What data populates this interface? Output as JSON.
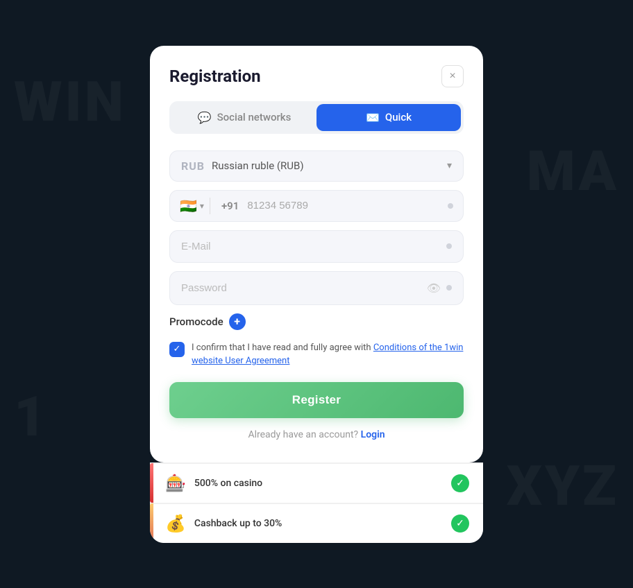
{
  "modal": {
    "title": "Registration",
    "close_label": "×",
    "tabs": [
      {
        "id": "social",
        "label": "Social networks",
        "icon": "💬",
        "active": false
      },
      {
        "id": "quick",
        "label": "Quick",
        "icon": "✉️",
        "active": true
      }
    ],
    "currency": {
      "code": "RUB",
      "name": "Russian ruble (RUB)",
      "chevron": "▾"
    },
    "phone": {
      "flag": "🇮🇳",
      "country_code": "+91",
      "placeholder": "81234 56789"
    },
    "email": {
      "placeholder": "E-Mail"
    },
    "password": {
      "placeholder": "Password"
    },
    "promocode": {
      "label": "Promocode",
      "add_icon": "+"
    },
    "agreement": {
      "text": "I confirm that I have read and fully agree with ",
      "link_text": "Conditions of the 1win website User Agreement"
    },
    "register_button": "Register",
    "login_text": "Already have an account?",
    "login_link": "Login"
  },
  "bonuses": [
    {
      "icon": "🎰",
      "text": "500% on casino",
      "check": "✓"
    },
    {
      "icon": "💰",
      "text": "Cashback up to 30%",
      "check": "✓"
    }
  ]
}
